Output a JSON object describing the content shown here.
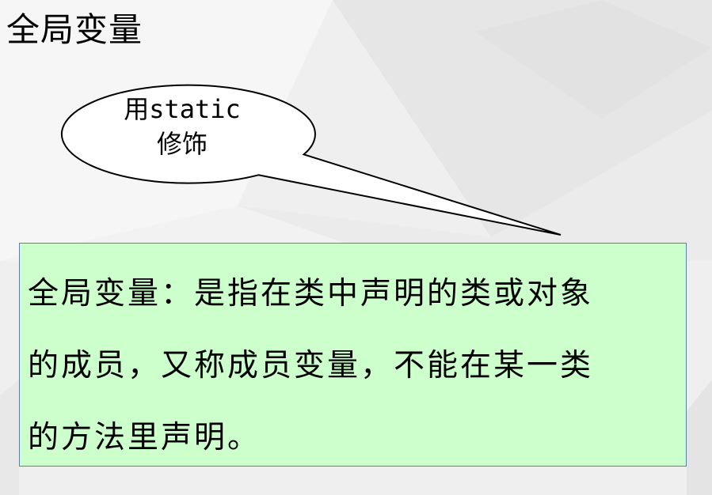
{
  "slide": {
    "title": "全局变量"
  },
  "callout": {
    "line1": "用static",
    "line2": "修饰"
  },
  "definition": {
    "line1": "全局变量：是指在类中声明的类或对象",
    "line2": "的成员，又称成员变量，不能在某一类",
    "line3": "的方法里声明。"
  },
  "colors": {
    "definition_background": "#ccffcc",
    "definition_border": "#5a7fb0",
    "callout_fill": "#ffffff",
    "text": "#000000"
  }
}
